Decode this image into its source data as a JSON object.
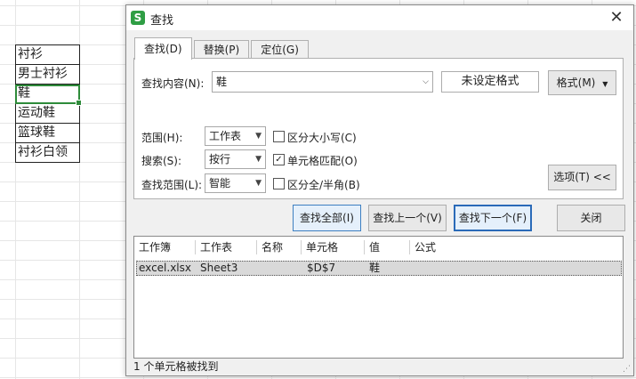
{
  "sheet": {
    "cells": [
      "衬衫",
      "男士衬衫",
      "鞋",
      "运动鞋",
      "篮球鞋",
      "衬衫白领"
    ],
    "active_index": 2,
    "accent": "#2e8b3a"
  },
  "dialog": {
    "title": "查找",
    "app_icon": "S",
    "close_glyph": "✕",
    "tabs": [
      {
        "label": "查找(D)",
        "active": true
      },
      {
        "label": "替换(P)",
        "active": false
      },
      {
        "label": "定位(G)",
        "active": false
      }
    ],
    "find": {
      "label": "查找内容(N):",
      "value": "鞋",
      "no_format_label": "未设定格式",
      "format_button": "格式(M)"
    },
    "options": {
      "scope_label": "范围(H):",
      "scope_value": "工作表",
      "search_label": "搜索(S):",
      "search_value": "按行",
      "lookin_label": "查找范围(L):",
      "lookin_value": "智能",
      "match_case_label": "区分大小写(C)",
      "match_case": false,
      "match_cell_label": "单元格匹配(O)",
      "match_cell": true,
      "width_label": "区分全/半角(B)",
      "width": false,
      "options_button": "选项(T) <<"
    },
    "buttons": {
      "find_all": "查找全部(I)",
      "find_prev": "查找上一个(V)",
      "find_next": "查找下一个(F)",
      "close": "关闭"
    },
    "results": {
      "columns": [
        "工作簿",
        "工作表",
        "名称",
        "单元格",
        "值",
        "公式"
      ],
      "rows": [
        {
          "workbook": "excel.xlsx",
          "sheet": "Sheet3",
          "name": "",
          "cell": "$D$7",
          "value": "鞋",
          "formula": ""
        }
      ]
    },
    "status": "1 个单元格被找到"
  }
}
